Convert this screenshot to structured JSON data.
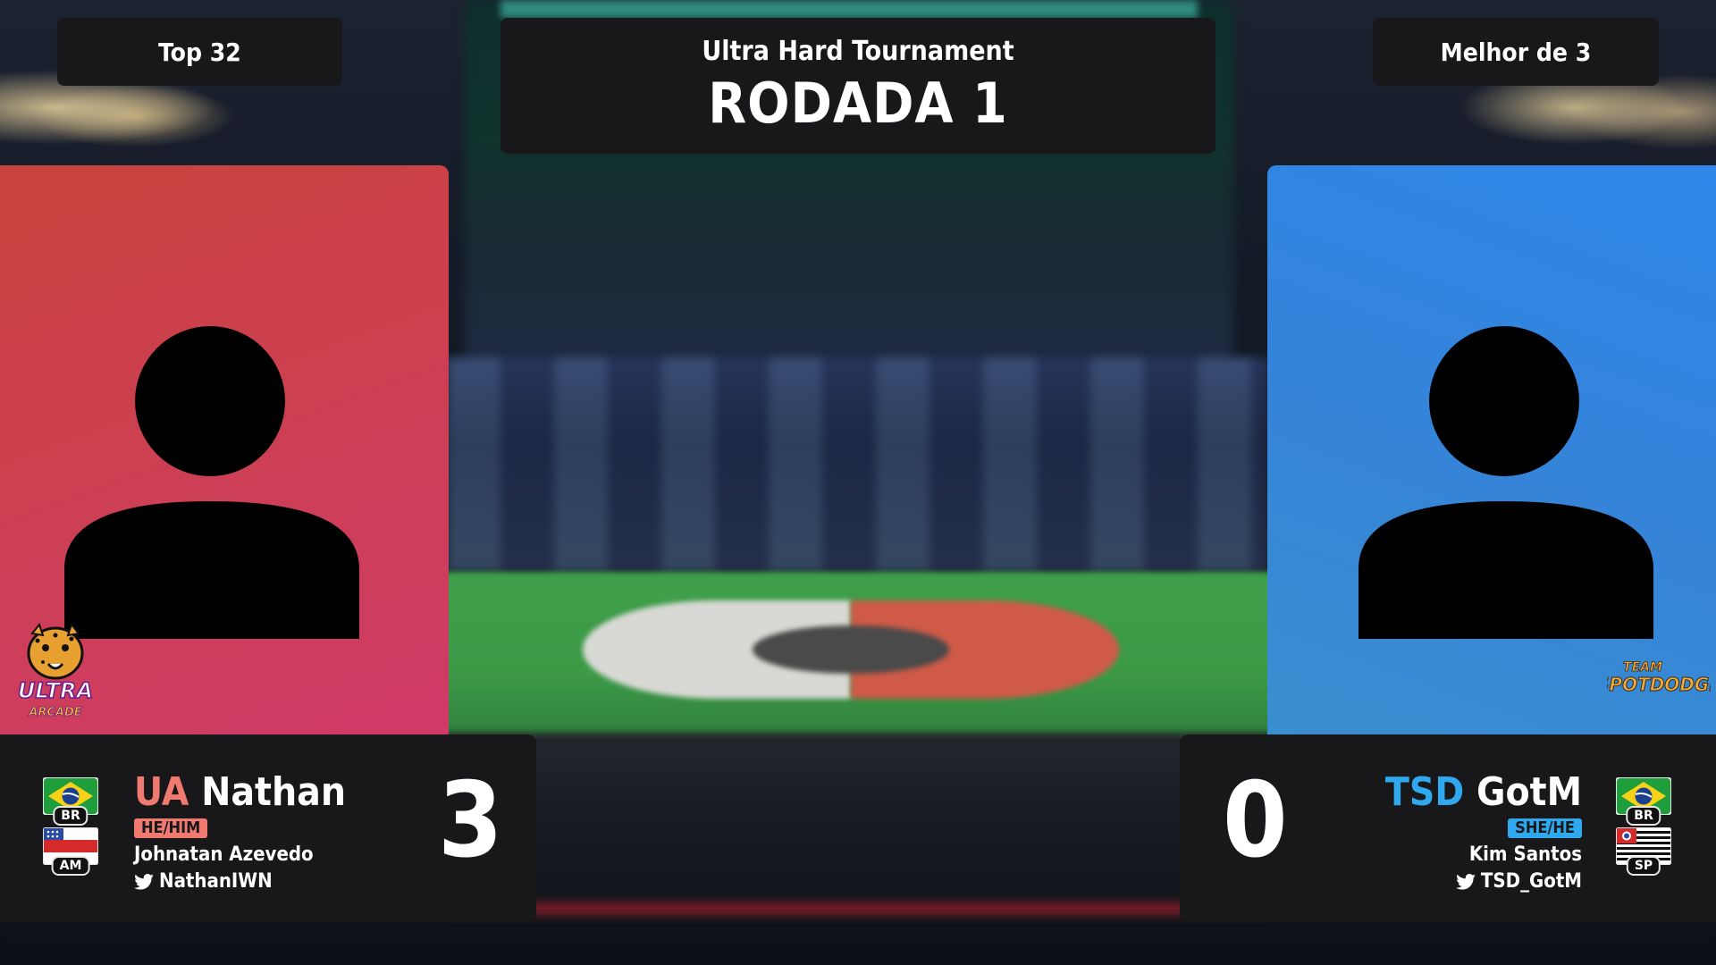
{
  "header": {
    "left_chip": "Top 32",
    "right_chip": "Melhor de 3",
    "tournament": "Ultra Hard Tournament",
    "round": "RODADA 1"
  },
  "colors": {
    "panel_bg": "#18181b",
    "left_card": "#cd3f55",
    "right_card": "#3584d8",
    "left_accent": "#f07a70",
    "right_accent": "#2fa8ee"
  },
  "player_left": {
    "team": "UA",
    "name": "Nathan",
    "pronouns": "HE/HIM",
    "real_name": "Johnatan Azevedo",
    "twitter": "NathanIWN",
    "score": "3",
    "country_code": "BR",
    "state_code": "AM",
    "team_logo_text": [
      "ULTRA",
      "ARCADE"
    ],
    "avatar_icon": "person-silhouette-icon"
  },
  "player_right": {
    "team": "TSD",
    "name": "GotM",
    "pronouns": "SHE/HE",
    "real_name": "Kim Santos",
    "twitter": "TSD_GotM",
    "score": "0",
    "country_code": "BR",
    "state_code": "SP",
    "team_logo_text": [
      "TEAM",
      "SPOTDODGE"
    ],
    "avatar_icon": "person-silhouette-icon"
  }
}
